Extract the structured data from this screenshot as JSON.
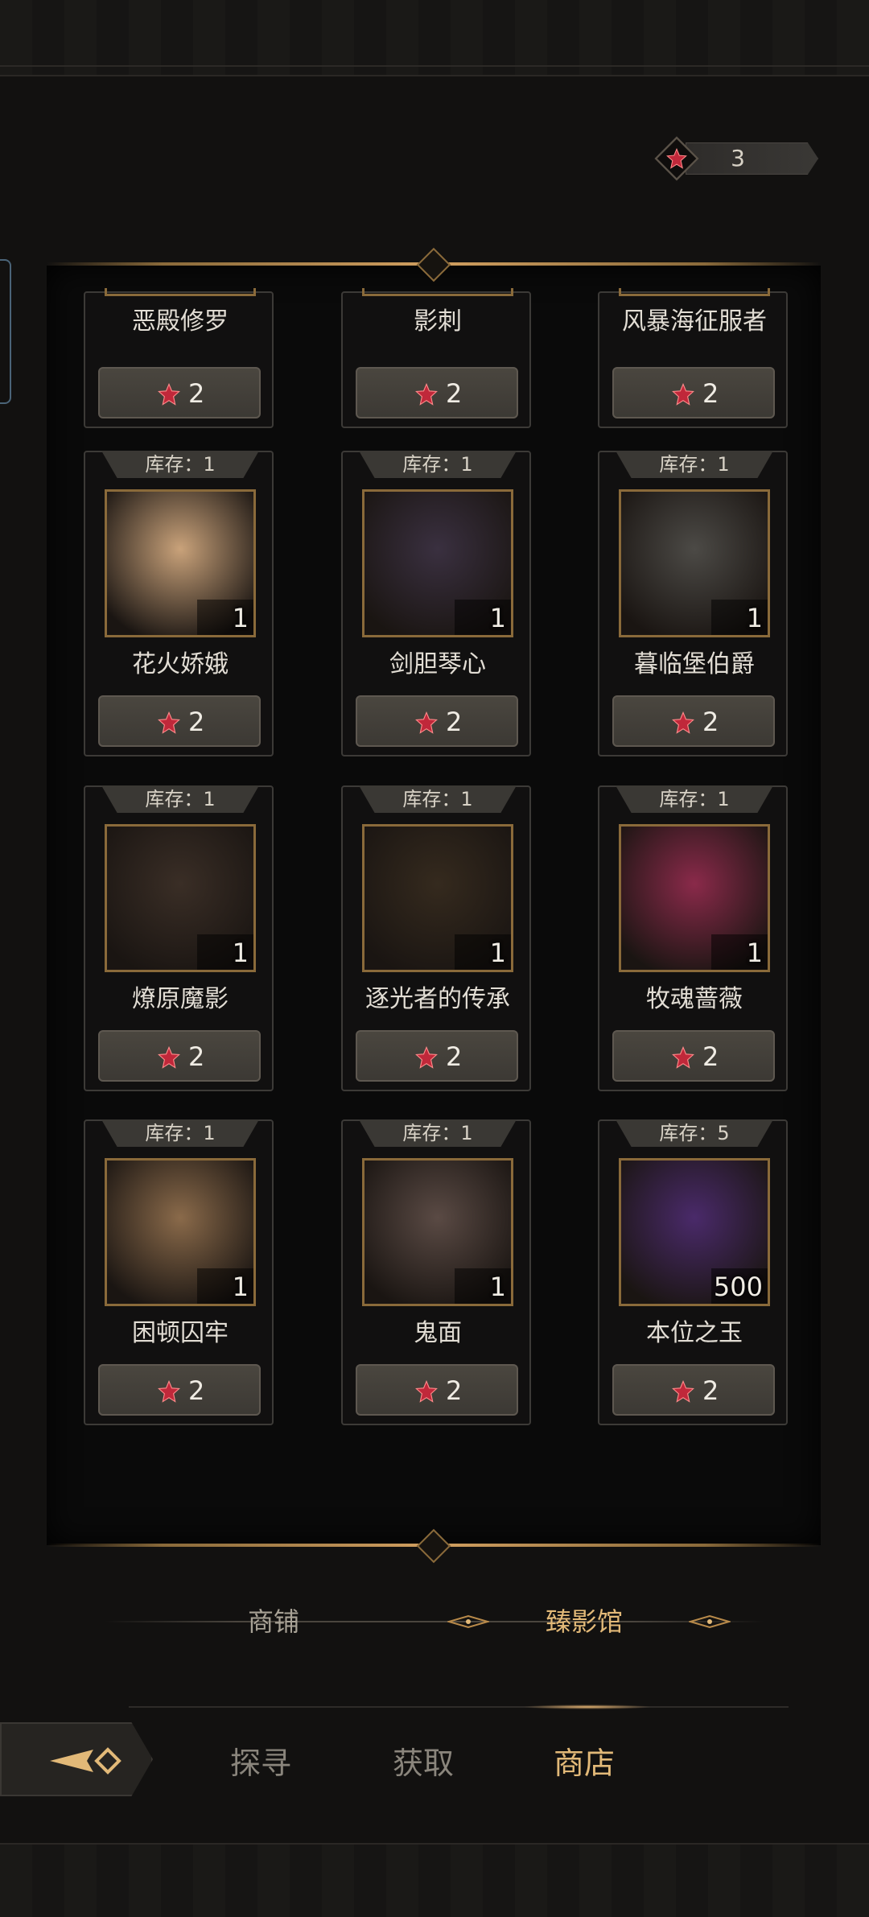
{
  "currency": {
    "amount": "3",
    "icon": "red-star-gem-icon",
    "color": "#c0283a"
  },
  "cut_row": [
    {
      "name": "恶殿修罗",
      "price": "2"
    },
    {
      "name": "影刺",
      "price": "2"
    },
    {
      "name": "风暴海征服者",
      "price": "2"
    }
  ],
  "items": [
    {
      "stock": "库存：1",
      "name": "花火娇娥",
      "qty": "1",
      "price": "2",
      "portrait_color": "#c9a27a"
    },
    {
      "stock": "库存：1",
      "name": "剑胆琴心",
      "qty": "1",
      "price": "2",
      "portrait_color": "#3a3040"
    },
    {
      "stock": "库存：1",
      "name": "暮临堡伯爵",
      "qty": "1",
      "price": "2",
      "portrait_color": "#4c4a46"
    },
    {
      "stock": "库存：1",
      "name": "燎原魔影",
      "qty": "1",
      "price": "2",
      "portrait_color": "#3a2e26"
    },
    {
      "stock": "库存：1",
      "name": "逐光者的传承",
      "qty": "1",
      "price": "2",
      "portrait_color": "#352a1e"
    },
    {
      "stock": "库存：1",
      "name": "牧魂蔷薇",
      "qty": "1",
      "price": "2",
      "portrait_color": "#8a2a4a"
    },
    {
      "stock": "库存：1",
      "name": "困顿囚牢",
      "qty": "1",
      "price": "2",
      "portrait_color": "#8a6a4a"
    },
    {
      "stock": "库存：1",
      "name": "鬼面",
      "qty": "1",
      "price": "2",
      "portrait_color": "#5a4a44"
    },
    {
      "stock": "库存：5",
      "name": "本位之玉",
      "qty": "500",
      "price": "2",
      "portrait_color": "#4a2a6a"
    }
  ],
  "subtabs": {
    "shop": "商铺",
    "gallery": "臻影馆"
  },
  "nav": {
    "explore": "探寻",
    "obtain": "获取",
    "store": "商店"
  },
  "colors": {
    "accent_gold": "#e2b978",
    "frame_gold": "#8a6a3a",
    "background": "#121110"
  }
}
